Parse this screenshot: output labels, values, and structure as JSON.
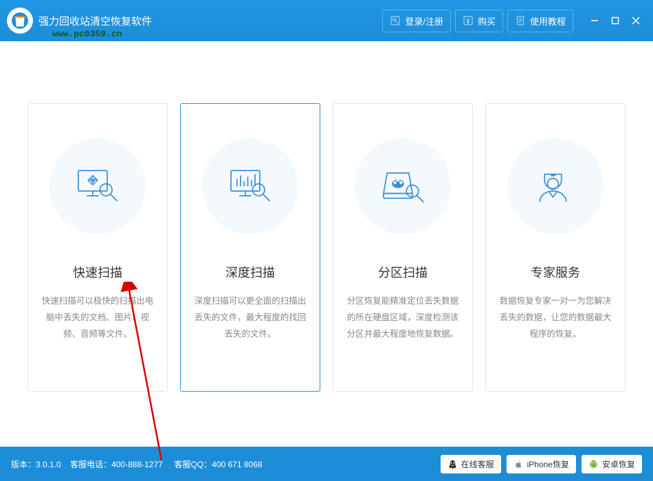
{
  "header": {
    "app_title": "强力回收站清空恢复软件",
    "watermark": "www.pc0359.cn",
    "login_label": "登录/注册",
    "buy_label": "购买",
    "tutorial_label": "使用教程"
  },
  "cards": [
    {
      "title": "快速扫描",
      "desc": "快速扫描可以极快的扫描出电脑中丢失的文档、图片、视频、音频等文件。"
    },
    {
      "title": "深度扫描",
      "desc": "深度扫描可以更全面的扫描出丢失的文件，最大程度的找回丢失的文件。"
    },
    {
      "title": "分区扫描",
      "desc": "分区恢复能精准定位丢失数据的所在硬盘区域，深度检测该分区并最大程度地恢复数据。"
    },
    {
      "title": "专家服务",
      "desc": "数据恢复专家一对一为您解决丢失的数据，让您的数据最大程序的恢复。"
    }
  ],
  "footer": {
    "version_label": "版本：",
    "version": "3.0.1.0",
    "phone_label": "客服电话：",
    "phone": "400-888-1277",
    "qq_label": "客服QQ：",
    "qq": "400 671 8068",
    "online_service": "在线客服",
    "iphone_recovery": "iPhone恢复",
    "android_recovery": "安卓恢复"
  }
}
